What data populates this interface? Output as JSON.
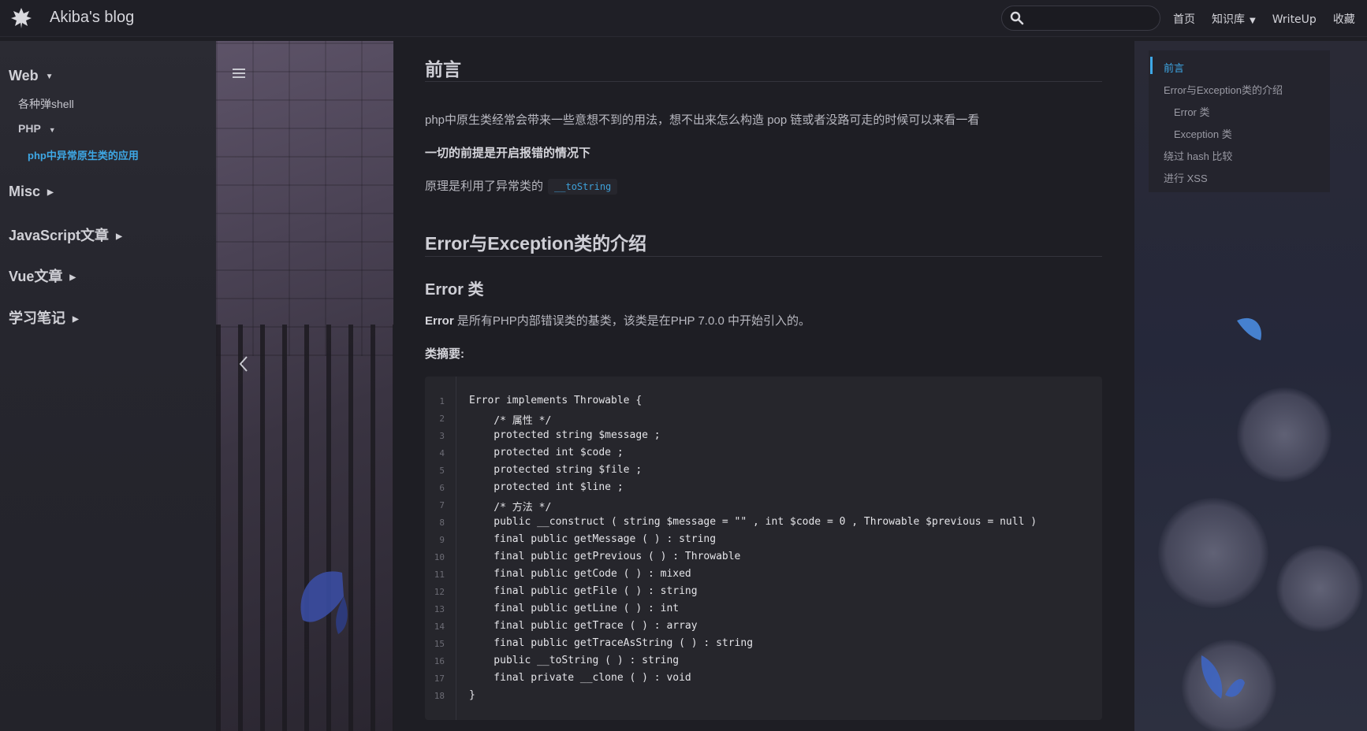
{
  "navbar": {
    "site_title": "Akiba's blog",
    "search_placeholder": "",
    "links": [
      "首页",
      "知识库",
      "WriteUp",
      "收藏"
    ]
  },
  "sidebar": {
    "groups": [
      {
        "label": "Web",
        "expanded": true
      },
      {
        "label": "Misc",
        "expanded": false
      },
      {
        "label": "JavaScript文章",
        "expanded": false
      },
      {
        "label": "Vue文章",
        "expanded": false
      },
      {
        "label": "学习笔记",
        "expanded": false
      }
    ],
    "web_items": [
      "各种弹shell",
      "PHP"
    ],
    "php_active_item": "php中异常原生类的应用"
  },
  "content": {
    "h_preface": "前言",
    "p1": "php中原生类经常会带来一些意想不到的用法，想不出来怎么构造 pop 链或者没路可走的时候可以来看一看",
    "p2": "一切的前提是开启报错的情况下",
    "p3": "原理是利用了异常类的",
    "p3_code": "__toString",
    "h_intro": "Error与Exception类的介绍",
    "h_error": "Error 类",
    "p4_bold": "Error",
    "p4_rest": " 是所有PHP内部错误类的基类，该类是在PHP 7.0.0 中开始引入的。",
    "p5": "类摘要:",
    "code_lines": [
      "Error implements Throwable {",
      "    /* 属性 */",
      "    protected string $message ;",
      "    protected int $code ;",
      "    protected string $file ;",
      "    protected int $line ;",
      "    /* 方法 */",
      "    public __construct ( string $message = \"\" , int $code = 0 , Throwable $previous = null )",
      "    final public getMessage ( ) : string",
      "    final public getPrevious ( ) : Throwable",
      "    final public getCode ( ) : mixed",
      "    final public getFile ( ) : string",
      "    final public getLine ( ) : int",
      "    final public getTrace ( ) : array",
      "    final public getTraceAsString ( ) : string",
      "    public __toString ( ) : string",
      "    final private __clone ( ) : void",
      "}"
    ],
    "line_numbers": [
      "1",
      "2",
      "3",
      "4",
      "5",
      "6",
      "7",
      "8",
      "9",
      "10",
      "11",
      "12",
      "13",
      "14",
      "15",
      "16",
      "17",
      "18"
    ]
  },
  "toc": {
    "items": [
      {
        "label": "前言",
        "active": true
      },
      {
        "label": "Error与Exception类的介绍",
        "active": false
      },
      {
        "label": "Error 类",
        "active": false
      },
      {
        "label": "Exception 类",
        "active": false
      },
      {
        "label": "绕过 hash 比较",
        "active": false
      },
      {
        "label": "进行 XSS",
        "active": false
      }
    ]
  },
  "colors": {
    "accent": "#3ea8e6",
    "background": "#1e1e24",
    "code_background": "#26262c"
  }
}
